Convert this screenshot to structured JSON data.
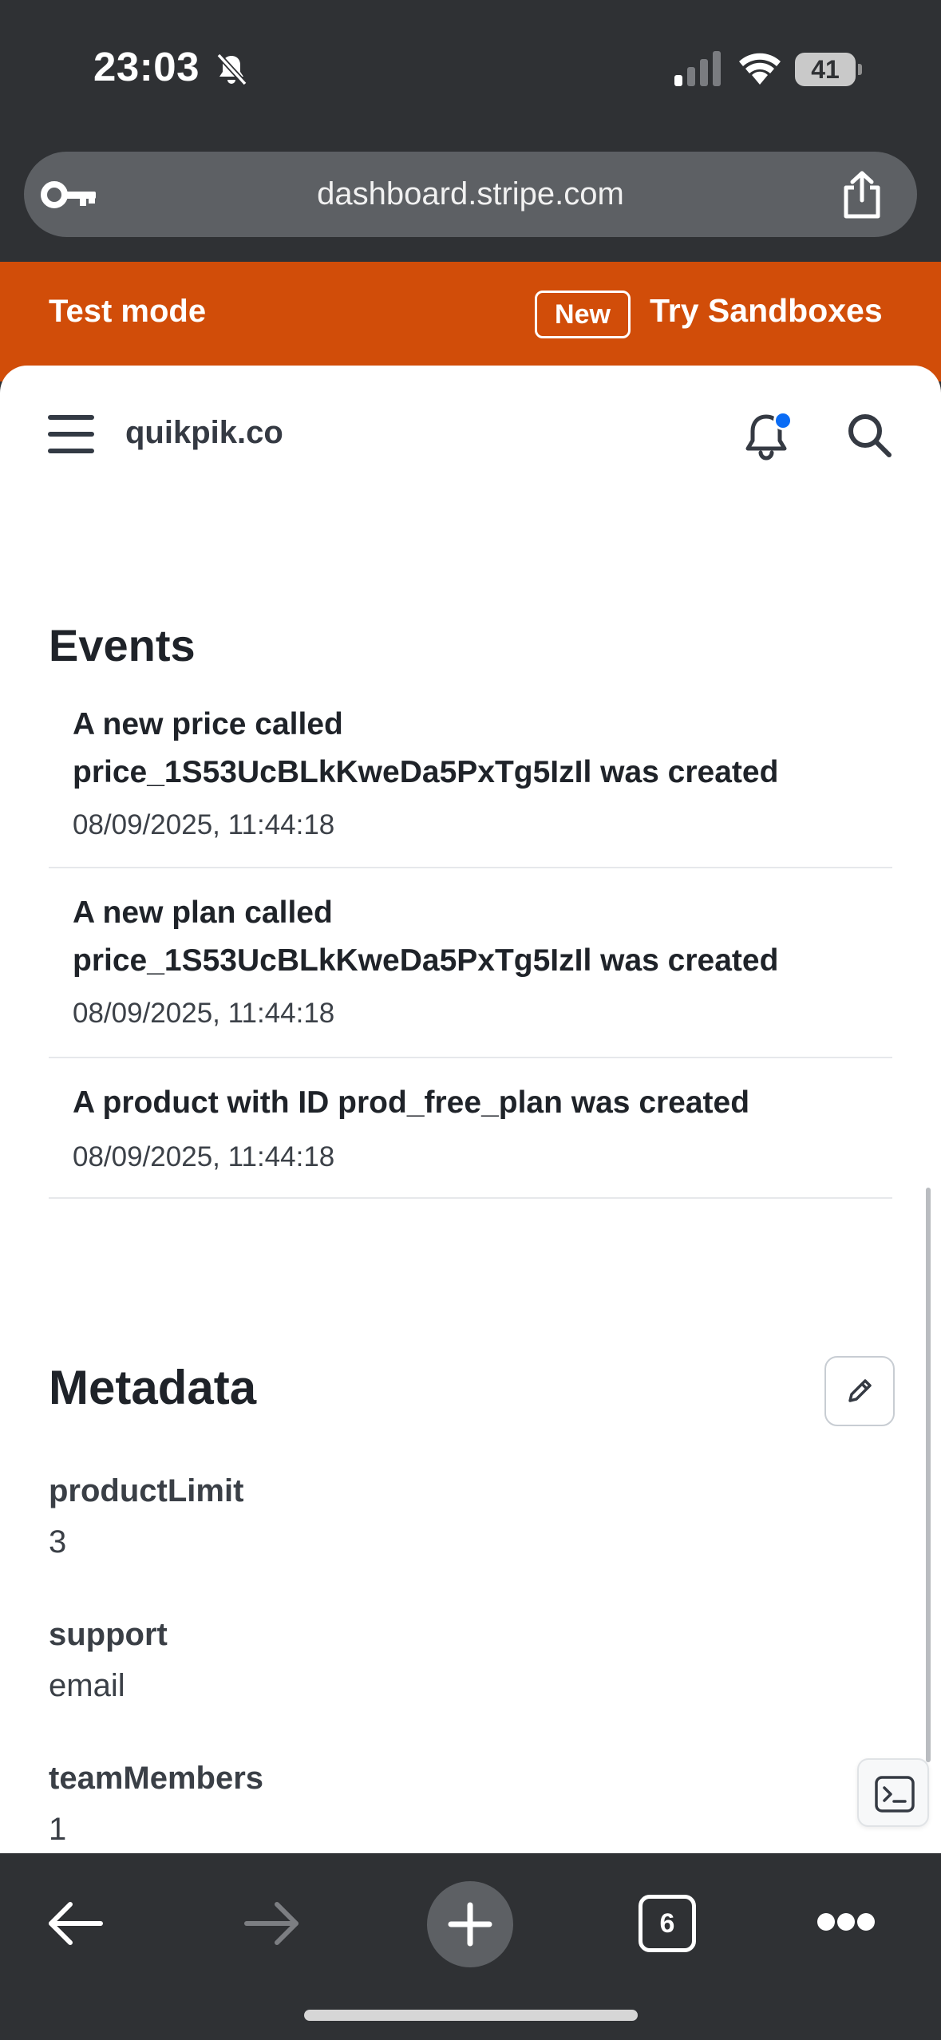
{
  "status_bar": {
    "time": "23:03",
    "battery": "41"
  },
  "browser": {
    "url": "dashboard.stripe.com",
    "open_tabs": "6"
  },
  "banner": {
    "mode": "Test mode",
    "badge": "New",
    "link": "Try Sandboxes",
    "color": "#d14d09"
  },
  "header": {
    "account": "quikpik.co"
  },
  "events": {
    "title": "Events",
    "items": [
      {
        "line1": "A new price called",
        "line2": "price_1S53UcBLkKweDa5PxTg5IzIl was created",
        "time": "08/09/2025, 11:44:18"
      },
      {
        "line1": "A new plan called",
        "line2": "price_1S53UcBLkKweDa5PxTg5IzIl was created",
        "time": "08/09/2025, 11:44:18"
      },
      {
        "line1": "A product with ID prod_free_plan was created",
        "time": "08/09/2025, 11:44:18"
      }
    ]
  },
  "metadata": {
    "title": "Metadata",
    "fields": [
      {
        "key": "productLimit",
        "value": "3"
      },
      {
        "key": "support",
        "value": "email"
      },
      {
        "key": "teamMembers",
        "value": "1"
      }
    ]
  },
  "colors": {
    "notification_dot": "#0a6cf5",
    "chrome": "#2f3134"
  }
}
